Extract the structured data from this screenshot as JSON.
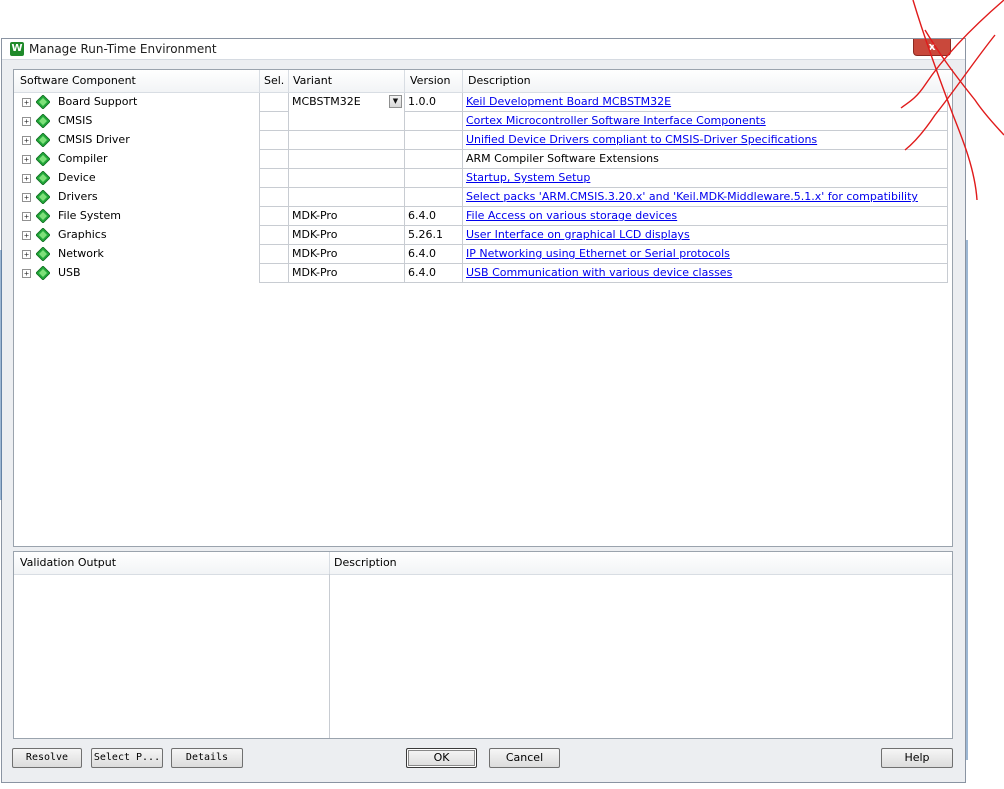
{
  "window": {
    "title": "Manage Run-Time Environment",
    "close_label": "x",
    "app_icon_glyph": "W"
  },
  "components": {
    "headers": [
      "Software Component",
      "Sel.",
      "Variant",
      "Version",
      "Description"
    ],
    "rows": [
      {
        "name": "Board Support",
        "sel": "",
        "variant": "MCBSTM32E",
        "has_dropdown": true,
        "version": "1.0.0",
        "description": "Keil Development Board MCBSTM32E",
        "is_link": true
      },
      {
        "name": "CMSIS",
        "sel": "",
        "variant": "",
        "has_dropdown": false,
        "version": "",
        "description": "Cortex Microcontroller Software Interface Components",
        "is_link": true
      },
      {
        "name": "CMSIS Driver",
        "sel": "",
        "variant": "",
        "has_dropdown": false,
        "version": "",
        "description": "Unified Device Drivers compliant to CMSIS-Driver Specifications",
        "is_link": true
      },
      {
        "name": "Compiler",
        "sel": "",
        "variant": "",
        "has_dropdown": false,
        "version": "",
        "description": "ARM Compiler Software Extensions",
        "is_link": false
      },
      {
        "name": "Device",
        "sel": "",
        "variant": "",
        "has_dropdown": false,
        "version": "",
        "description": "Startup, System Setup",
        "is_link": true
      },
      {
        "name": "Drivers",
        "sel": "",
        "variant": "",
        "has_dropdown": false,
        "version": "",
        "description": "Select packs 'ARM.CMSIS.3.20.x' and 'Keil.MDK-Middleware.5.1.x' for compatibility",
        "is_link": true
      },
      {
        "name": "File System",
        "sel": "",
        "variant": "MDK-Pro",
        "has_dropdown": false,
        "version": "6.4.0",
        "description": "File Access on various storage devices",
        "is_link": true
      },
      {
        "name": "Graphics",
        "sel": "",
        "variant": "MDK-Pro",
        "has_dropdown": false,
        "version": "5.26.1",
        "description": "User Interface on graphical LCD displays",
        "is_link": true
      },
      {
        "name": "Network",
        "sel": "",
        "variant": "MDK-Pro",
        "has_dropdown": false,
        "version": "6.4.0",
        "description": "IP Networking using Ethernet or Serial protocols",
        "is_link": true
      },
      {
        "name": "USB",
        "sel": "",
        "variant": "MDK-Pro",
        "has_dropdown": false,
        "version": "6.4.0",
        "description": "USB Communication with various device classes",
        "is_link": true
      }
    ]
  },
  "validation": {
    "headers": [
      "Validation Output",
      "Description"
    ]
  },
  "buttons": {
    "resolve": "Resolve",
    "select_packs": "Select P...",
    "details": "Details",
    "ok": "OK",
    "cancel": "Cancel",
    "help": "Help"
  },
  "colors": {
    "link": "#0000ee",
    "component_icon": "#22a83a",
    "annotation_mark": "#e01b1b"
  },
  "icons": {
    "expander": "plus-box-icon",
    "component": "green-diamond-icon",
    "dropdown": "chevron-down-icon"
  }
}
